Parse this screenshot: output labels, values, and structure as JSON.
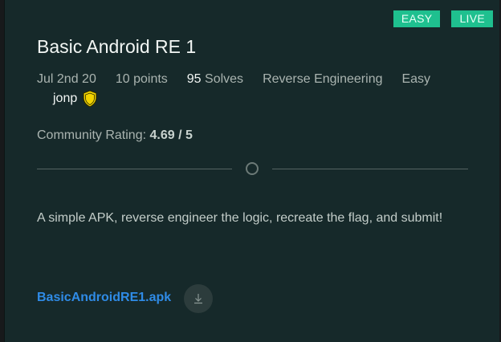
{
  "badges": {
    "difficulty": "EASY",
    "status": "LIVE"
  },
  "challenge": {
    "title": "Basic Android RE 1",
    "date": "Jul 2nd 20",
    "points": "10 points",
    "solves_count": "95",
    "solves_label": "Solves",
    "category": "Reverse Engineering",
    "difficulty": "Easy",
    "author": "jonp",
    "author_icon": "shield-icon",
    "rating_label": "Community Rating:",
    "rating_value": "4.69 / 5",
    "description": "A simple APK, reverse engineer the logic, recreate the flag, and submit!",
    "file_name": "BasicAndroidRE1.apk",
    "download_icon": "download-icon"
  },
  "colors": {
    "card_bg": "#16292a",
    "badge_bg": "#1fc08f",
    "link": "#2f8be6",
    "shield_fill": "#f2d300"
  }
}
